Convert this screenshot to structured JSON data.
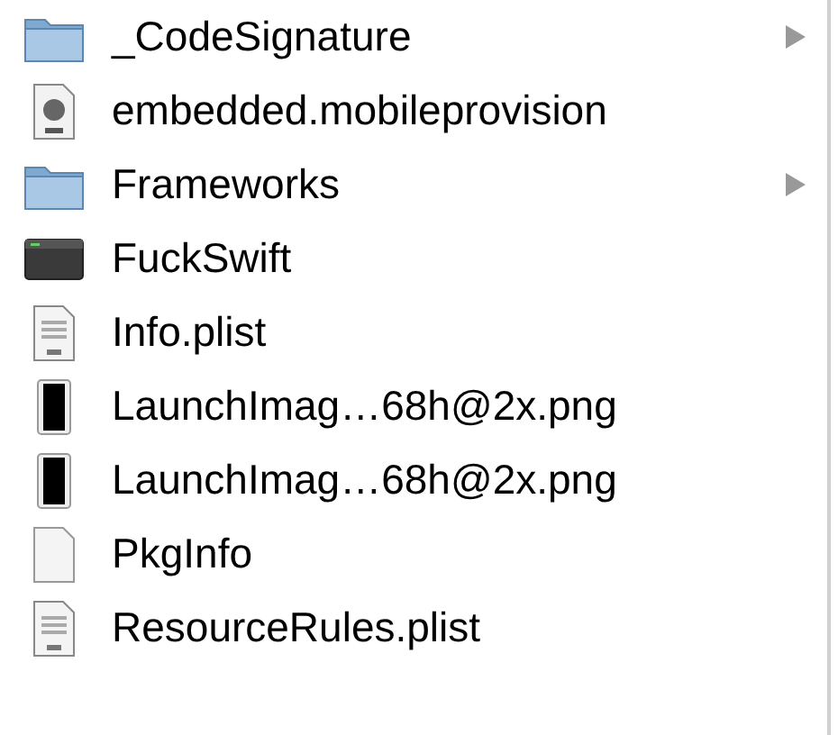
{
  "items": [
    {
      "name": "_CodeSignature",
      "kind": "folder"
    },
    {
      "name": "embedded.mobileprovision",
      "kind": "provision"
    },
    {
      "name": "Frameworks",
      "kind": "folder"
    },
    {
      "name": "FuckSwift",
      "kind": "executable"
    },
    {
      "name": "Info.plist",
      "kind": "plist"
    },
    {
      "name": "LaunchImag…68h@2x.png",
      "kind": "image"
    },
    {
      "name": "LaunchImag…68h@2x.png",
      "kind": "image"
    },
    {
      "name": "PkgInfo",
      "kind": "file"
    },
    {
      "name": "ResourceRules.plist",
      "kind": "plist"
    }
  ]
}
